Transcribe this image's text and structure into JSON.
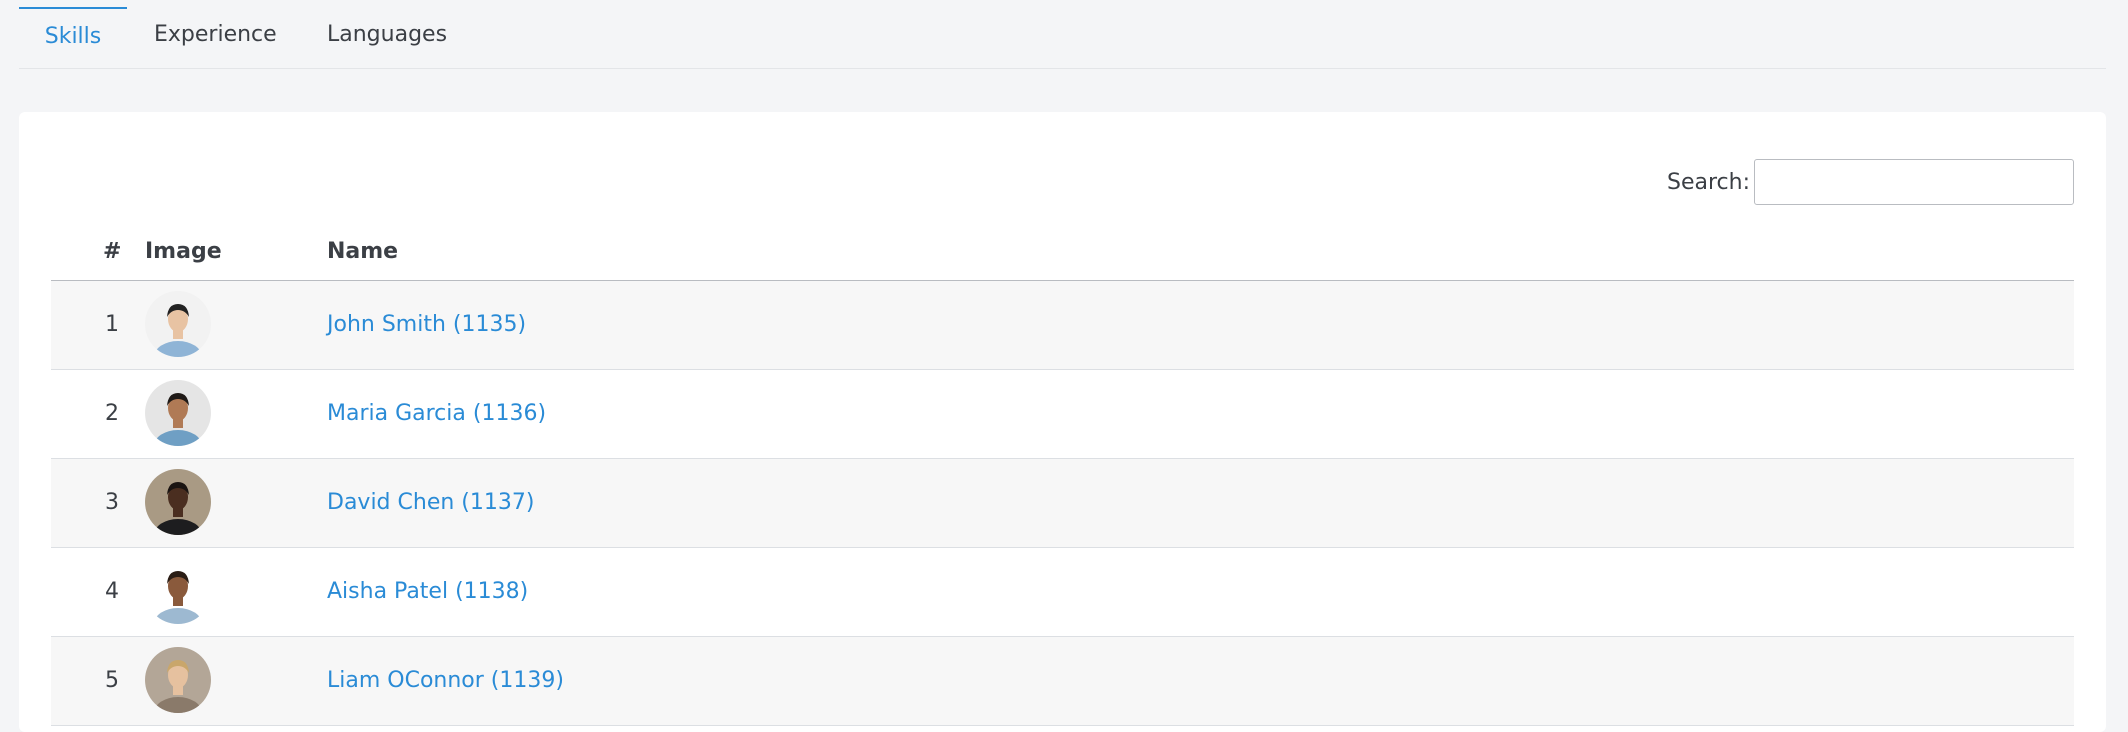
{
  "tabs": [
    {
      "label": "Skills",
      "active": true
    },
    {
      "label": "Experience",
      "active": false
    },
    {
      "label": "Languages",
      "active": false
    }
  ],
  "search": {
    "label": "Search:",
    "value": "",
    "placeholder": ""
  },
  "table": {
    "headers": {
      "num": "#",
      "image": "Image",
      "name": "Name"
    },
    "rows": [
      {
        "num": "1",
        "name": "John Smith (1135)",
        "avatar": {
          "bg": "#f2f2f2",
          "skin": "#e8c3a3",
          "hair": "#222222",
          "shirt": "#8fb4d6"
        }
      },
      {
        "num": "2",
        "name": "Maria Garcia (1136)",
        "avatar": {
          "bg": "#e5e5e5",
          "skin": "#b07a55",
          "hair": "#1f1a17",
          "shirt": "#6f9fc4"
        }
      },
      {
        "num": "3",
        "name": "David Chen (1137)",
        "avatar": {
          "bg": "#a99a84",
          "skin": "#4a2e20",
          "hair": "#1a1412",
          "shirt": "#1d1d1f"
        }
      },
      {
        "num": "4",
        "name": "Aisha Patel (1138)",
        "avatar": {
          "bg": "#ffffff",
          "skin": "#8a5a3c",
          "hair": "#2a1d15",
          "shirt": "#9db9d1"
        }
      },
      {
        "num": "5",
        "name": "Liam OConnor (1139)",
        "avatar": {
          "bg": "#b3a697",
          "skin": "#e6c19f",
          "hair": "#c9a66b",
          "shirt": "#8a7a6a"
        }
      }
    ]
  },
  "colors": {
    "accent": "#2a8bd6",
    "text": "#3b3f45",
    "row_stripe": "#f7f7f7"
  }
}
